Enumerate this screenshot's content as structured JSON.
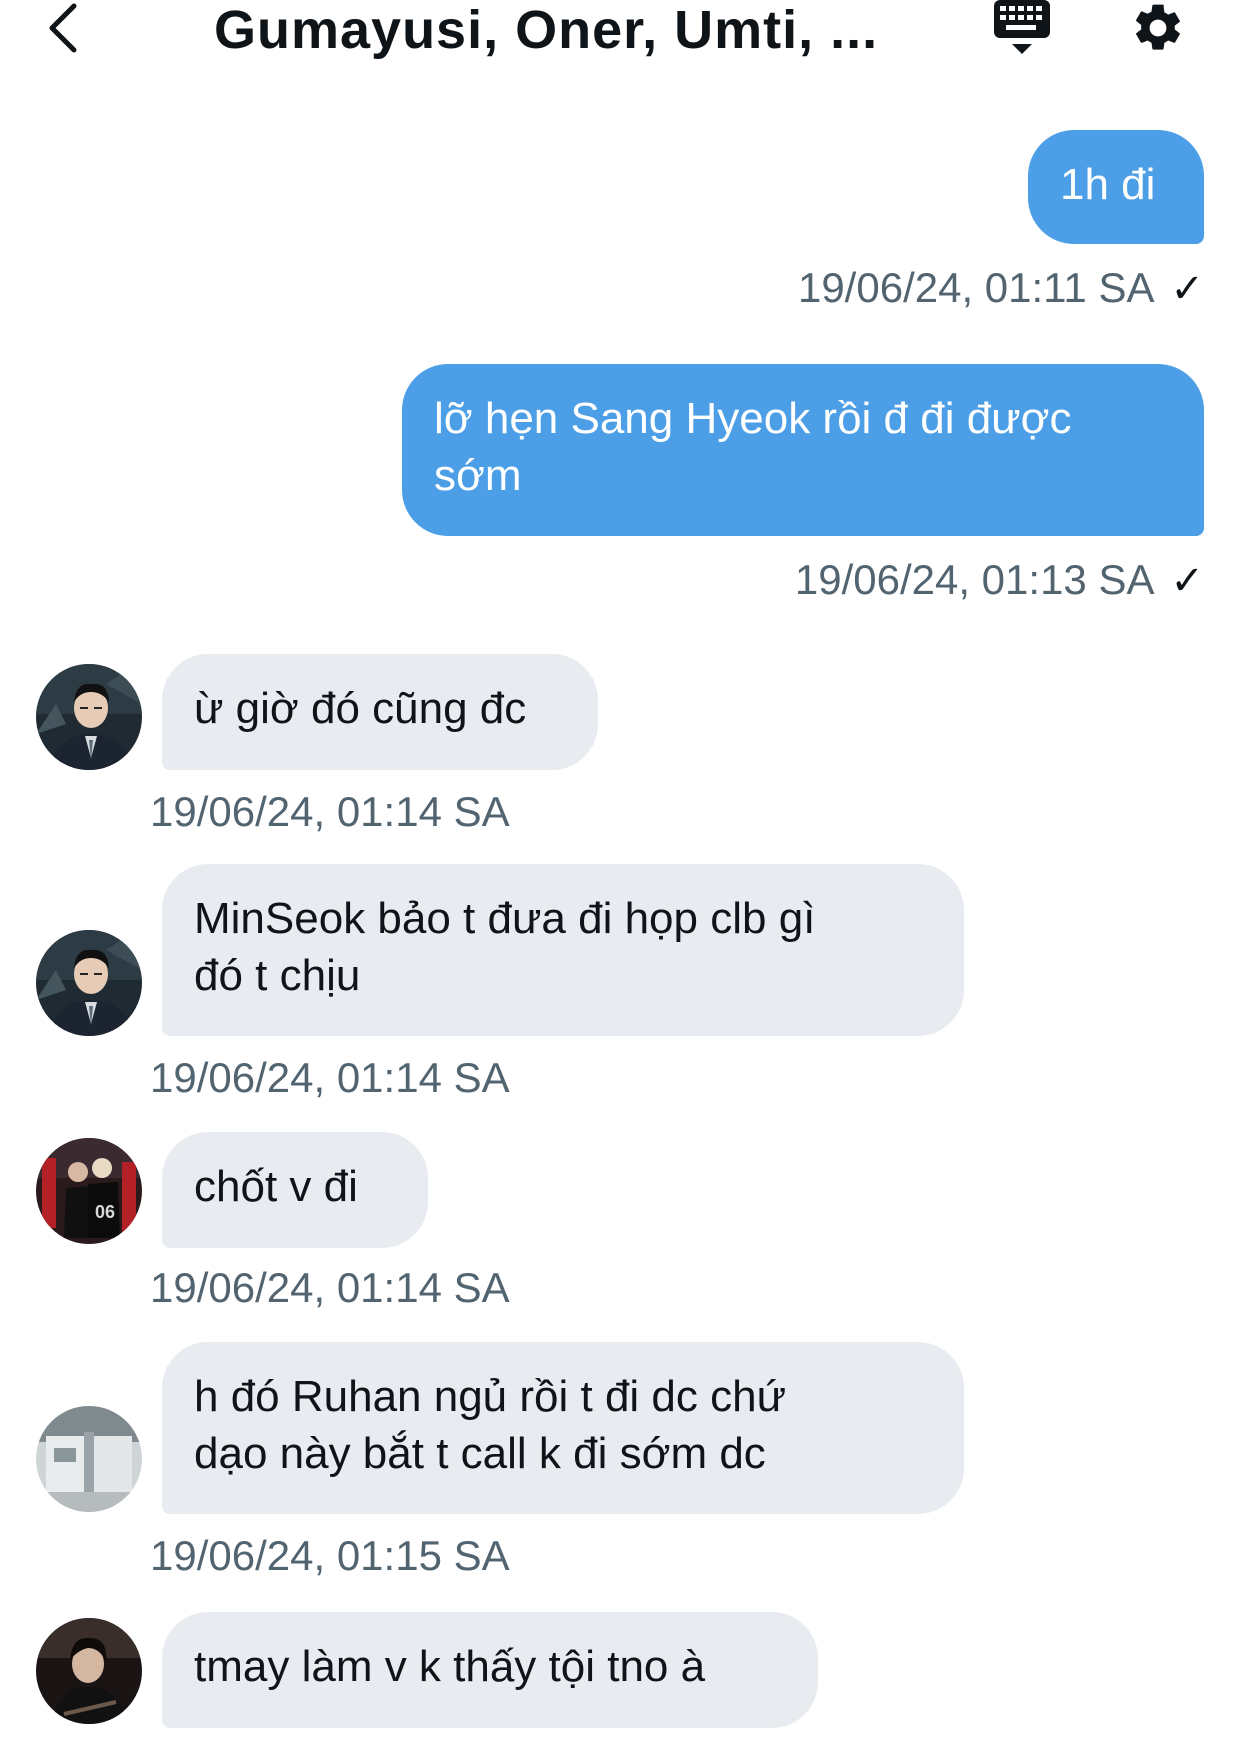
{
  "header": {
    "title": "Gumayusi, Oner, Umti, ...",
    "back_icon": "chevron-left-icon",
    "keyboard_icon": "keyboard-icon",
    "settings_icon": "gear-icon"
  },
  "messages": [
    {
      "direction": "out",
      "text": "1h đi",
      "timestamp": "19/06/24, 01:11 SA",
      "status": "✓"
    },
    {
      "direction": "out",
      "text": "lỡ hẹn Sang Hyeok rồi đ đi được\nsớm",
      "timestamp": "19/06/24, 01:13 SA",
      "status": "✓"
    },
    {
      "direction": "in",
      "text": "ừ giờ đó cũng đc",
      "timestamp": "19/06/24, 01:14 SA"
    },
    {
      "direction": "in",
      "text": "MinSeok bảo t đưa đi họp clb gì\nđó t chịu",
      "timestamp": "19/06/24, 01:14 SA"
    },
    {
      "direction": "in",
      "text": "chốt v đi",
      "timestamp": "19/06/24, 01:14 SA"
    },
    {
      "direction": "in",
      "text": "h đó Ruhan ngủ rồi t đi dc chứ\ndạo này bắt t call k đi sớm dc",
      "timestamp": "19/06/24, 01:15 SA"
    },
    {
      "direction": "in",
      "text": "tmay làm v k thấy tội tno à"
    }
  ],
  "colors": {
    "outgoing_bubble": "#4c9fe7",
    "incoming_bubble": "#e8ecf0",
    "timestamp_text": "#536471"
  }
}
